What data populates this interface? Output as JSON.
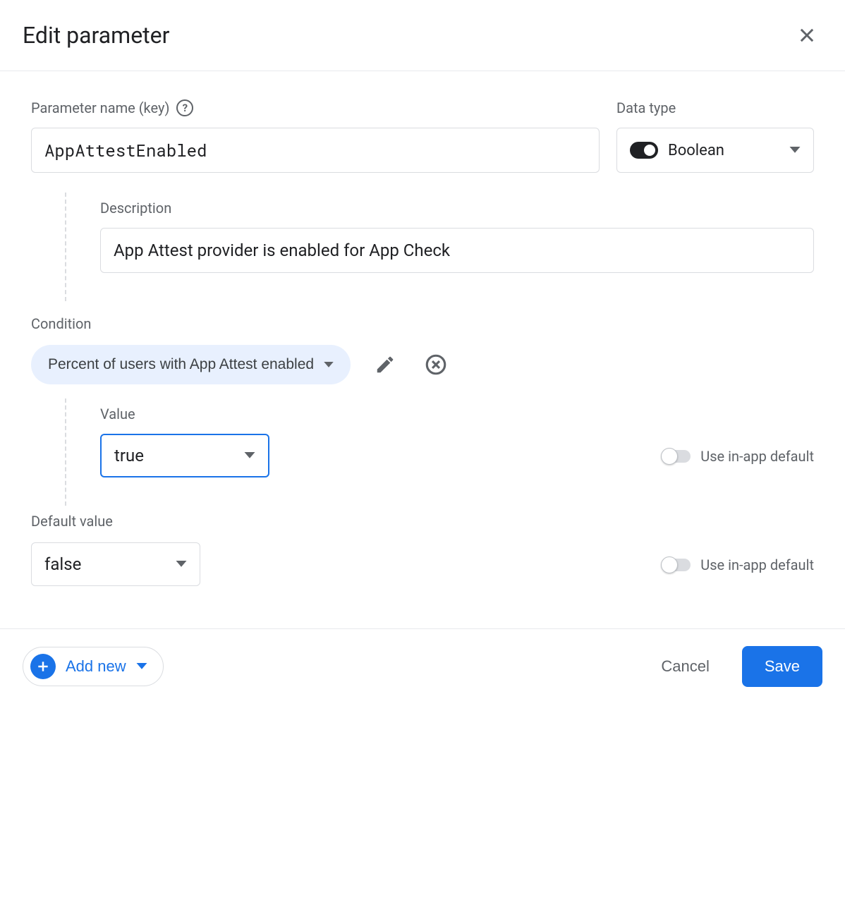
{
  "header": {
    "title": "Edit parameter"
  },
  "form": {
    "name_label": "Parameter name (key)",
    "name_value": "AppAttestEnabled",
    "type_label": "Data type",
    "type_value": "Boolean",
    "desc_label": "Description",
    "desc_value": "App Attest provider is enabled for App Check"
  },
  "condition": {
    "label": "Condition",
    "chip": "Percent of users with App Attest enabled",
    "value_label": "Value",
    "value": "true",
    "use_default_label": "Use in-app default"
  },
  "default": {
    "label": "Default value",
    "value": "false",
    "use_default_label": "Use in-app default"
  },
  "footer": {
    "add_new": "Add new",
    "cancel": "Cancel",
    "save": "Save"
  }
}
